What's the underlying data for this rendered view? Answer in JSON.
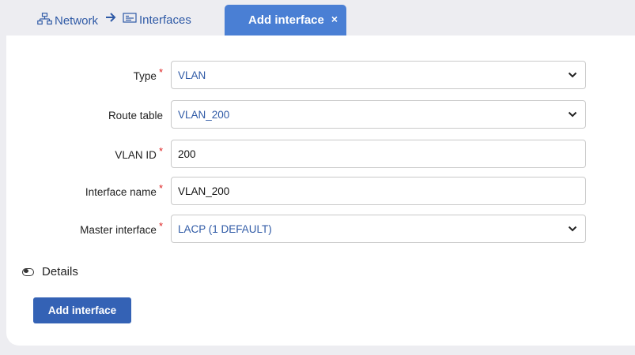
{
  "breadcrumb": {
    "network_label": "Network",
    "network_icon": "network-icon",
    "arrow_icon": "arrow-right-icon",
    "interfaces_label": "Interfaces",
    "interfaces_icon": "interfaces-icon"
  },
  "tab": {
    "label": "Add interface",
    "close_glyph": "×"
  },
  "form": {
    "type": {
      "label": "Type",
      "required": "*",
      "value": "VLAN"
    },
    "route_table": {
      "label": "Route table",
      "value": "VLAN_200"
    },
    "vlan_id": {
      "label": "VLAN ID",
      "required": "*",
      "value": "200"
    },
    "interface_name": {
      "label": "Interface name",
      "required": "*",
      "value": "VLAN_200"
    },
    "master_interface": {
      "label": "Master interface",
      "required": "*",
      "value": "LACP (1 DEFAULT)"
    }
  },
  "details": {
    "label": "Details",
    "icon": "toggle-icon"
  },
  "actions": {
    "add_label": "Add interface"
  },
  "colors": {
    "accent": "#4a7fd4",
    "link": "#2f5aa6",
    "button": "#3462b5",
    "required": "#dd2222"
  }
}
